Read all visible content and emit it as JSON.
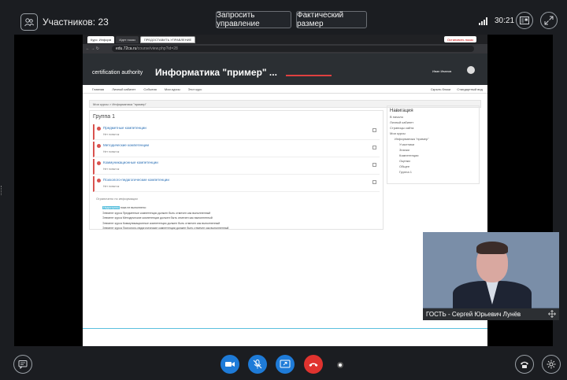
{
  "header": {
    "participants_label": "Участников: 23",
    "request_control_label": "Запросить управление",
    "actual_size_label": "Фактический размер",
    "clock": "30:21"
  },
  "shared_screen": {
    "tabs": [
      "Курс: Информ",
      "Идет показ",
      "ПРЕДОСТАВИТЬ УПРАВЛЕНИЕ"
    ],
    "stop_share_label": "Остановить показ",
    "url_host": "edu.72ca.ru",
    "url_path": "/course/view.php?id=28",
    "site_brand": "certification authority",
    "course_title": "Информатика \"пример\" ...",
    "user_name": "Иван Иванов",
    "nav_items": [
      "Главная",
      "Личный кабинет",
      "События",
      "Мои курсы",
      "Этот курс"
    ],
    "nav_right": [
      "Скрыть блоки",
      "Стандартный вид"
    ],
    "breadcrumb": "Мои курсы  >  Информатика \"пример\"",
    "group_title": "Группа 1",
    "activities": [
      {
        "name": "Предметные компетенции",
        "sub": "Нет попыток"
      },
      {
        "name": "Методические компетенции",
        "sub": "Нет попыток"
      },
      {
        "name": "Коммуникационные компетенции",
        "sub": "Нет попыток"
      },
      {
        "name": "Психолого-педагогические компетенции",
        "sub": "Нет попыток"
      }
    ],
    "restricted_head": "Ограничено по информации",
    "restricted_badge": "Недоступно",
    "restricted_first": "пока не выполнено:",
    "restricted_lines": [
      "Элемент курса Предметные компетенции должен быть отмечен как выполненный",
      "Элемент курса Методические компетенции должен быть отмечен как выполненный",
      "Элемент курса Коммуникационные компетенции должен быть отмечен как выполненный",
      "Элемент курса Психолого-педагогические компетенции должен быть отмечен как выполненный"
    ],
    "nav_block_title": "Навигация",
    "nav_block_items": [
      "В начало",
      "Личный кабинет",
      "Страницы сайта",
      "Мои курсы",
      "Информатика \"пример\"",
      "Участники",
      "Значки",
      "Компетенции",
      "Оценки",
      "Общее",
      "Группа 1"
    ]
  },
  "video": {
    "caption": "ГОСТЬ - Сергей Юрьевич Лунёв"
  },
  "colors": {
    "cam_blue": "#1e7bd8",
    "end_red": "#e0332f"
  }
}
